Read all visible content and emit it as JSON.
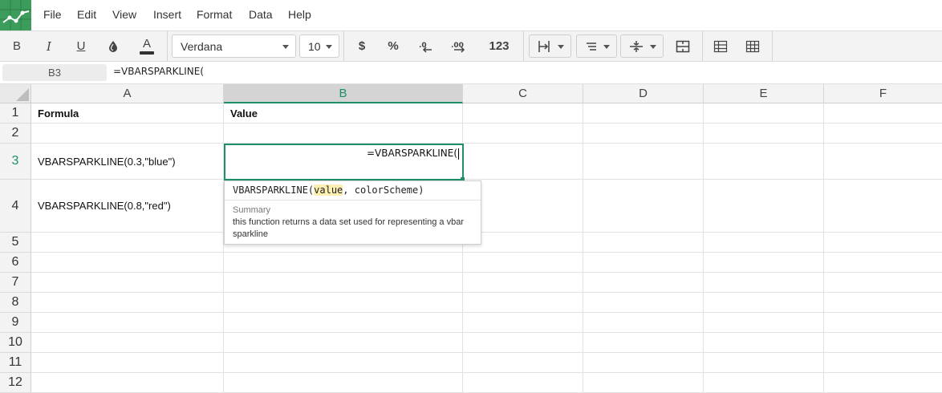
{
  "menu": {
    "items": [
      "File",
      "Edit",
      "View",
      "Insert",
      "Format",
      "Data",
      "Help"
    ]
  },
  "toolbar": {
    "bold": "B",
    "italic": "I",
    "underline": "U",
    "font_color": "A",
    "font_family": "Verdana",
    "font_size": "10",
    "currency": "$",
    "percent": "%",
    "number_format": "123"
  },
  "formula_bar": {
    "cell_ref": "B3",
    "content": "=VBARSPARKLINE("
  },
  "columns": [
    "A",
    "B",
    "C",
    "D",
    "E",
    "F"
  ],
  "rows": [
    "1",
    "2",
    "3",
    "4",
    "5",
    "6",
    "7",
    "8",
    "9",
    "10",
    "11",
    "12"
  ],
  "cells": {
    "a1": "Formula",
    "b1": "Value",
    "a3": "VBARSPARKLINE(0.3,\"blue\")",
    "a4": "VBARSPARKLINE(0.8,\"red\")"
  },
  "editor": {
    "text": "=VBARSPARKLINE("
  },
  "autocomplete": {
    "fn_name": "VBARSPARKLINE(",
    "param_active": "value",
    "params_rest": ", colorScheme)",
    "summary_label": "Summary",
    "summary_text": "this function returns a data set used for representing a vbar sparkline"
  },
  "colors": {
    "accent": "#1d8f6a",
    "logo_bg": "#3c9c5c",
    "highlight": "#fdeeb2"
  }
}
